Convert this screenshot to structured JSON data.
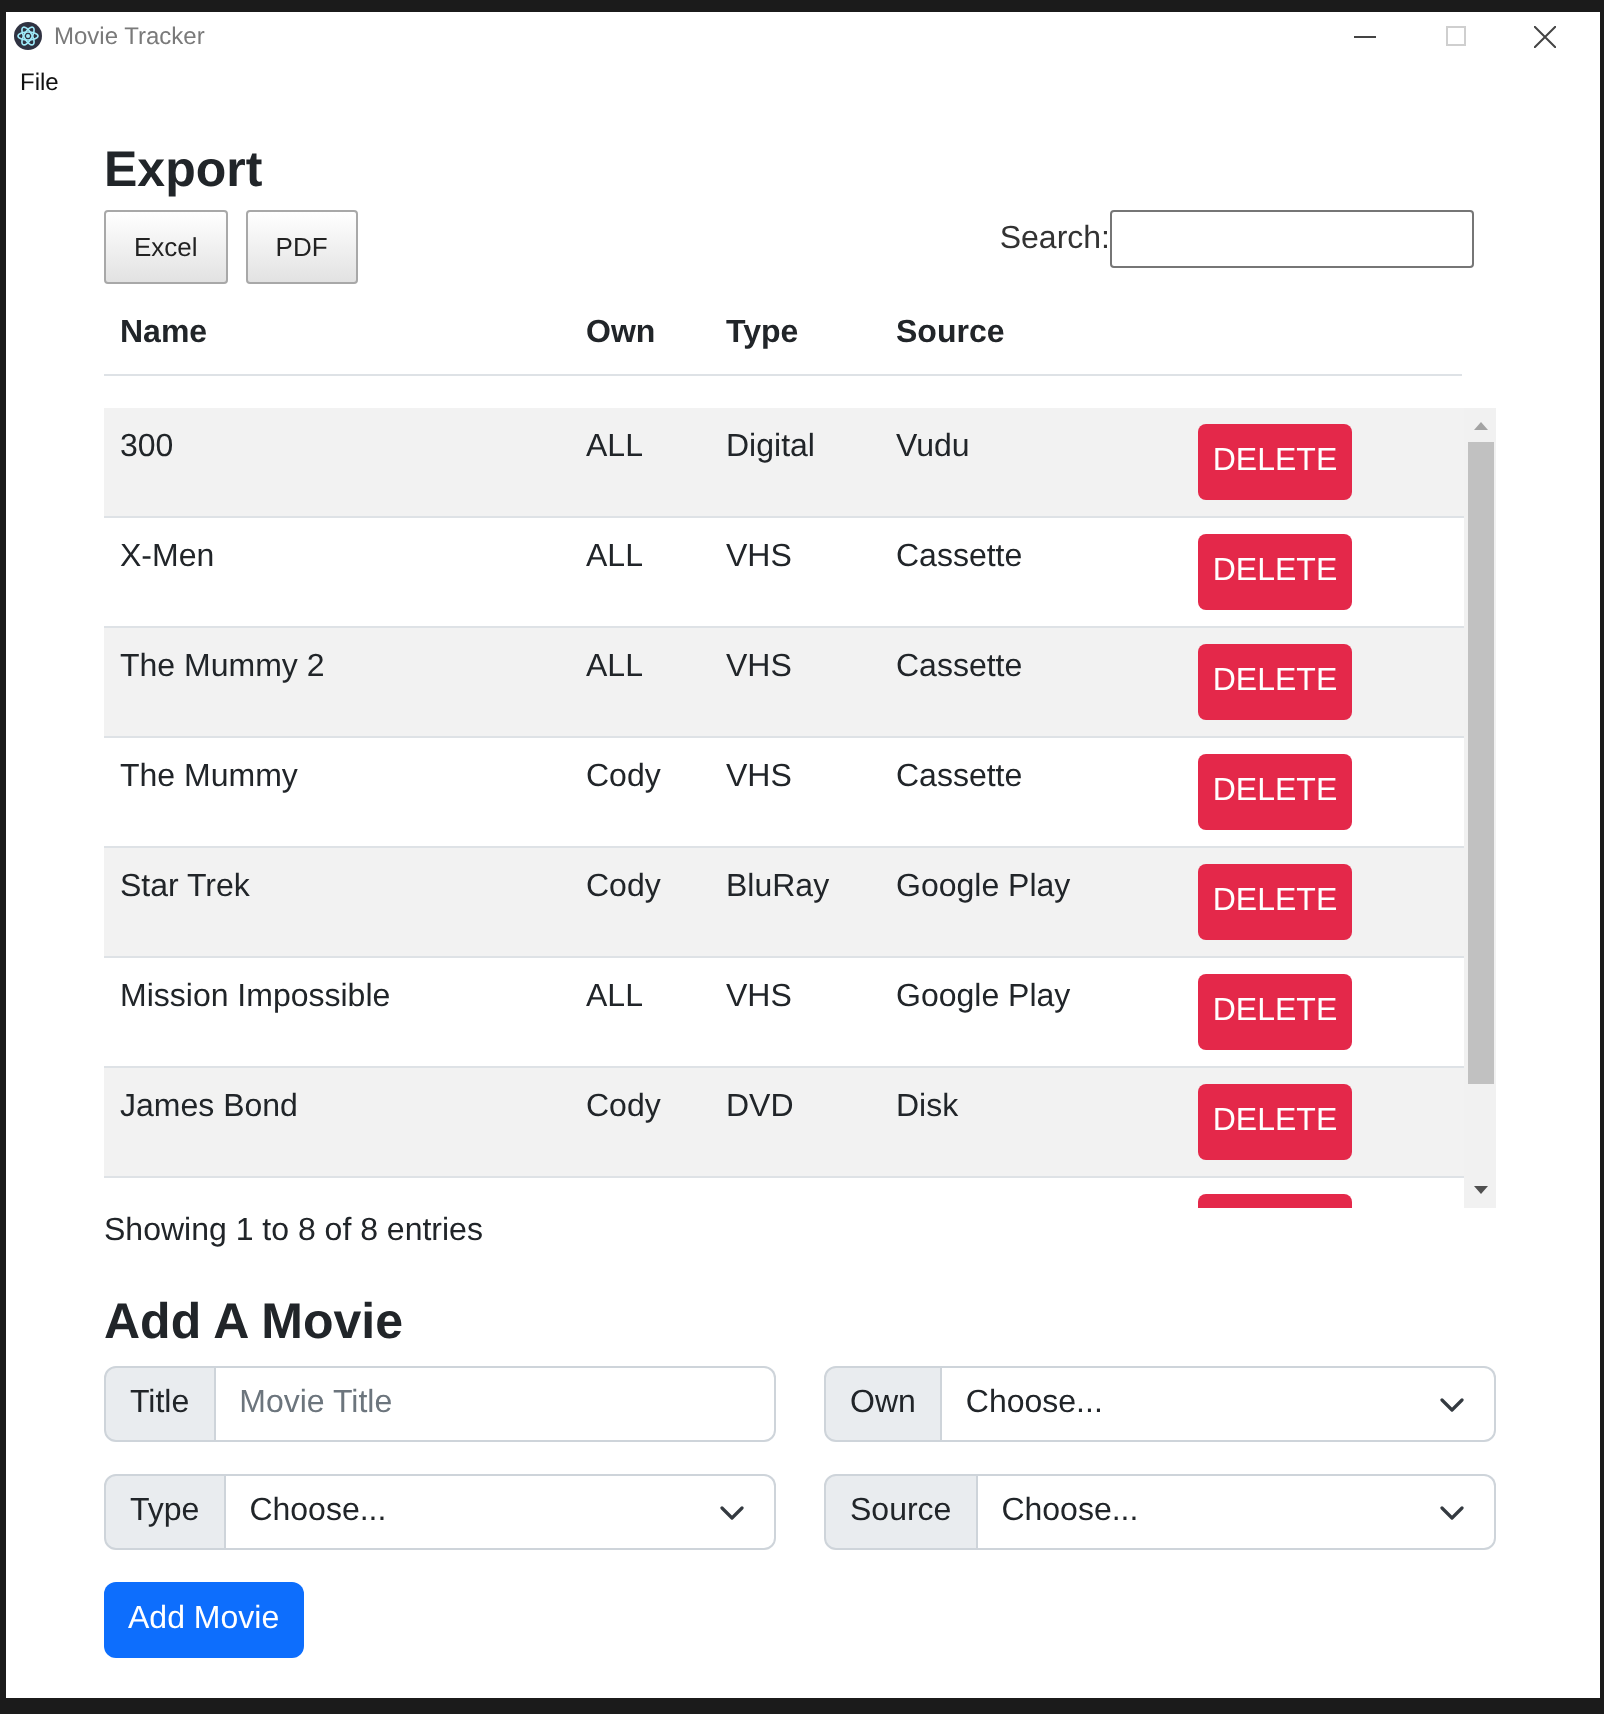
{
  "window": {
    "title": "Movie Tracker",
    "controls": [
      {
        "kind": "minimize",
        "disabled": false
      },
      {
        "kind": "maximize",
        "disabled": true
      },
      {
        "kind": "close",
        "disabled": false
      }
    ]
  },
  "menu_bar": [
    "File"
  ],
  "export": {
    "title": "Export",
    "buttons": [
      "Excel",
      "PDF"
    ],
    "search": {
      "label": "Search:"
    }
  },
  "table": {
    "columns": [
      "Name",
      "Own",
      "Type",
      "Source"
    ],
    "rows": [
      {
        "cells": [
          "300",
          "ALL",
          "Digital",
          "Vudu"
        ],
        "action": "DELETE"
      },
      {
        "cells": [
          "X-Men",
          "ALL",
          "VHS",
          "Cassette"
        ],
        "action": "DELETE"
      },
      {
        "cells": [
          "The Mummy 2",
          "ALL",
          "VHS",
          "Cassette"
        ],
        "action": "DELETE"
      },
      {
        "cells": [
          "The Mummy",
          "Cody",
          "VHS",
          "Cassette"
        ],
        "action": "DELETE"
      },
      {
        "cells": [
          "Star Trek",
          "Cody",
          "BluRay",
          "Google Play"
        ],
        "action": "DELETE"
      },
      {
        "cells": [
          "Mission Impossible",
          "ALL",
          "VHS",
          "Google Play"
        ],
        "action": "DELETE"
      },
      {
        "cells": [
          "James Bond",
          "Cody",
          "DVD",
          "Disk"
        ],
        "action": "DELETE"
      }
    ],
    "partial_row_below": true,
    "info": "Showing 1 to 8 of 8 entries"
  },
  "add_movie": {
    "title": "Add A Movie",
    "fields": [
      {
        "kind": "text",
        "label": "Title",
        "placeholder": "Movie Title"
      },
      {
        "kind": "select",
        "label": "Own",
        "value": "Choose..."
      },
      {
        "kind": "select",
        "label": "Type",
        "value": "Choose..."
      },
      {
        "kind": "select",
        "label": "Source",
        "value": "Choose..."
      }
    ],
    "submit": "Add Movie"
  }
}
